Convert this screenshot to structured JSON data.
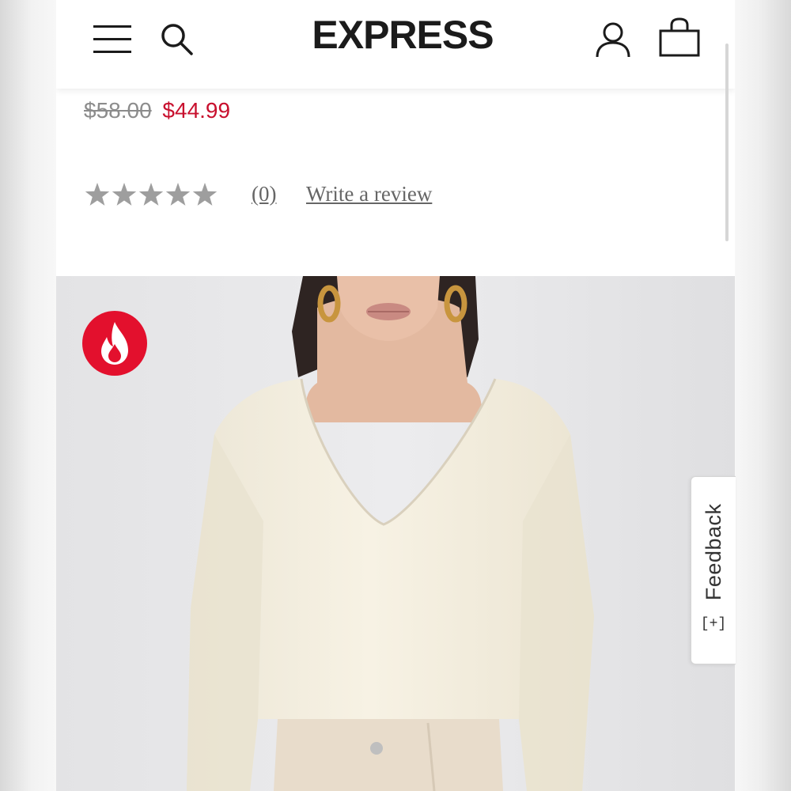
{
  "header": {
    "logo": "EXPRESS",
    "icons": {
      "menu": "hamburger-menu-icon",
      "search": "search-icon",
      "account": "account-icon",
      "bag": "shopping-bag-icon"
    }
  },
  "product": {
    "original_price": "$58.00",
    "sale_price": "$44.99",
    "rating": {
      "stars_filled": 0,
      "stars_total": 5,
      "review_count": "(0)",
      "write_review_label": "Write a review"
    },
    "badge_icon": "flame-icon"
  },
  "feedback_tab": {
    "label": "Feedback",
    "icon": "[+]"
  },
  "colors": {
    "sale_red": "#c8102e",
    "badge_red": "#e3102d",
    "star_gray": "#9e9e9e",
    "logo_black": "#1b1b1b"
  }
}
